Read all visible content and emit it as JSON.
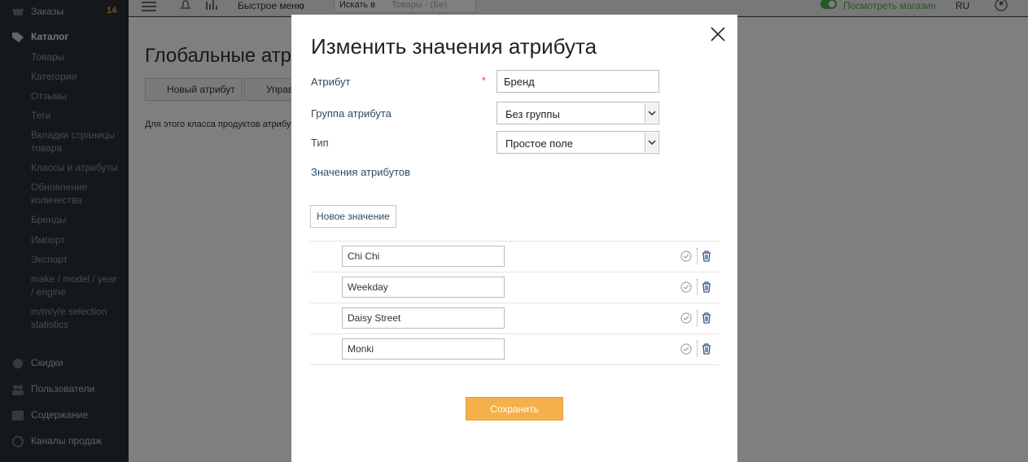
{
  "sidebar": {
    "orders": {
      "label": "Заказы",
      "count": "14"
    },
    "catalog": {
      "label": "Каталог"
    },
    "items": [
      "Товары",
      "Категории",
      "Отзывы",
      "Теги",
      "Вкладки страницы товара",
      "Классы и атрибуты",
      "Обновление количества",
      "Бренды",
      "Импорт",
      "Экспорт",
      "make / model / year / engine",
      "m/m/y/e selection statistics"
    ],
    "discounts": "Скидки",
    "users": "Пользователи",
    "content": "Содержание",
    "sales_channels": "Каналы продаж"
  },
  "topbar": {
    "quick_menu": "Быстрое меню",
    "search_in": "Искать в",
    "search_placeholder": "Товары - (Бе)",
    "view_store": "Посмотреть магазин",
    "lang": "RU"
  },
  "page": {
    "title": "Глобальные атрибуты",
    "new_attr_btn": "Новый атрибут",
    "manage_btn": "Управление",
    "note": "Для этого класса продуктов атрибуты"
  },
  "modal": {
    "title": "Изменить значения атрибута",
    "attribute_label": "Атрибут",
    "attribute_value": "Бренд",
    "group_label": "Группа атрибута",
    "group_value": "Без группы",
    "type_label": "Тип",
    "type_value": "Простое поле",
    "values_label": "Значения атрибутов",
    "new_value_btn": "Новое значение",
    "values": [
      "Chi Chi",
      "Weekday",
      "Daisy Street",
      "Monki"
    ],
    "save_btn": "Сохранить"
  },
  "colors": {
    "accent": "#f4b04a",
    "sidebar_bg": "#2b3035",
    "label": "#2e4a62",
    "required": "#e53935"
  }
}
